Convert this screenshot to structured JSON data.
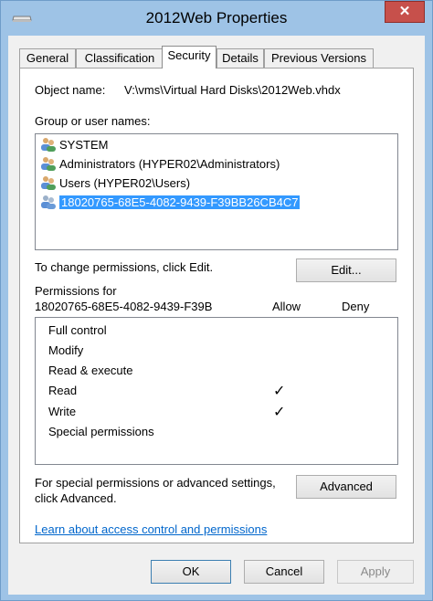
{
  "window": {
    "title": "2012Web Properties",
    "close_glyph": "✕"
  },
  "tabs": [
    {
      "label": "General"
    },
    {
      "label": "Classification"
    },
    {
      "label": "Security"
    },
    {
      "label": "Details"
    },
    {
      "label": "Previous Versions"
    }
  ],
  "security": {
    "object_name_label": "Object name:",
    "object_name_value": "V:\\vms\\Virtual Hard Disks\\2012Web.vhdx",
    "group_label": "Group or user names:",
    "users": [
      {
        "name": "SYSTEM",
        "icon": "users-group-icon"
      },
      {
        "name": "Administrators (HYPER02\\Administrators)",
        "icon": "users-group-icon"
      },
      {
        "name": "Users (HYPER02\\Users)",
        "icon": "users-group-icon"
      },
      {
        "name": "18020765-68E5-4082-9439-F39BB26CB4C7",
        "icon": "users-group-icon",
        "selected": true
      }
    ],
    "change_text": "To change permissions, click Edit.",
    "edit_button": "Edit...",
    "permissions_for_label": "Permissions for",
    "permissions_for_value": "18020765-68E5-4082-9439-F39B",
    "allow_header": "Allow",
    "deny_header": "Deny",
    "permissions": [
      {
        "name": "Full control",
        "allow": "",
        "deny": ""
      },
      {
        "name": "Modify",
        "allow": "",
        "deny": ""
      },
      {
        "name": "Read & execute",
        "allow": "",
        "deny": ""
      },
      {
        "name": "Read",
        "allow": "✓",
        "deny": ""
      },
      {
        "name": "Write",
        "allow": "✓",
        "deny": ""
      },
      {
        "name": "Special permissions",
        "allow": "",
        "deny": ""
      }
    ],
    "advanced_text_line1": "For special permissions or advanced settings,",
    "advanced_text_line2": "click Advanced.",
    "advanced_button": "Advanced",
    "learn_link": "Learn about access control and permissions"
  },
  "footer": {
    "ok": "OK",
    "cancel": "Cancel",
    "apply": "Apply"
  },
  "colors": {
    "selection": "#3399ff",
    "link": "#0066cc",
    "close": "#c7504b"
  }
}
